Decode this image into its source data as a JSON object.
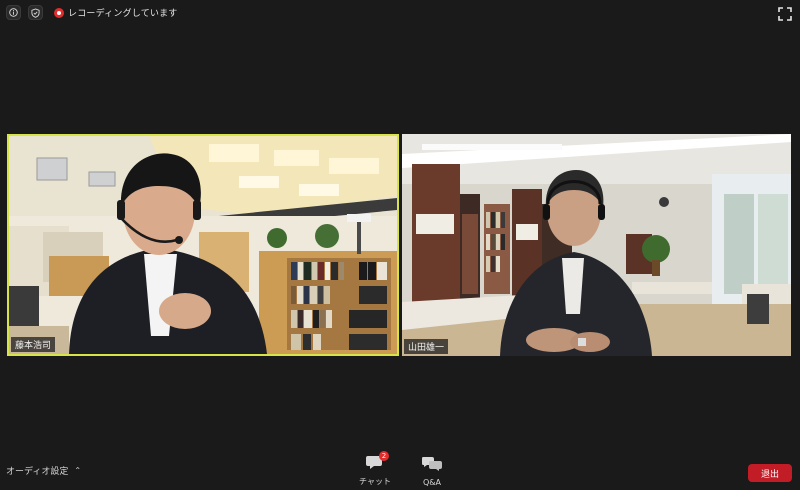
{
  "topbar": {
    "recording_label": "レコーディングしています",
    "icons": [
      "info-icon",
      "shield-icon",
      "recording-icon",
      "fullscreen-icon"
    ]
  },
  "participants": [
    {
      "name": "藤本浩司",
      "active_speaker": true
    },
    {
      "name": "山田雄一",
      "active_speaker": false
    }
  ],
  "bottombar": {
    "audio_settings_label": "オーディオ設定",
    "chat_label": "チャット",
    "chat_badge": "2",
    "qa_label": "Q&A",
    "leave_label": "退出"
  },
  "colors": {
    "active_speaker_border": "#d6e44a",
    "leave_button": "#c21d27",
    "badge": "#e02d2d",
    "recording_dot": "#e02d2d"
  }
}
